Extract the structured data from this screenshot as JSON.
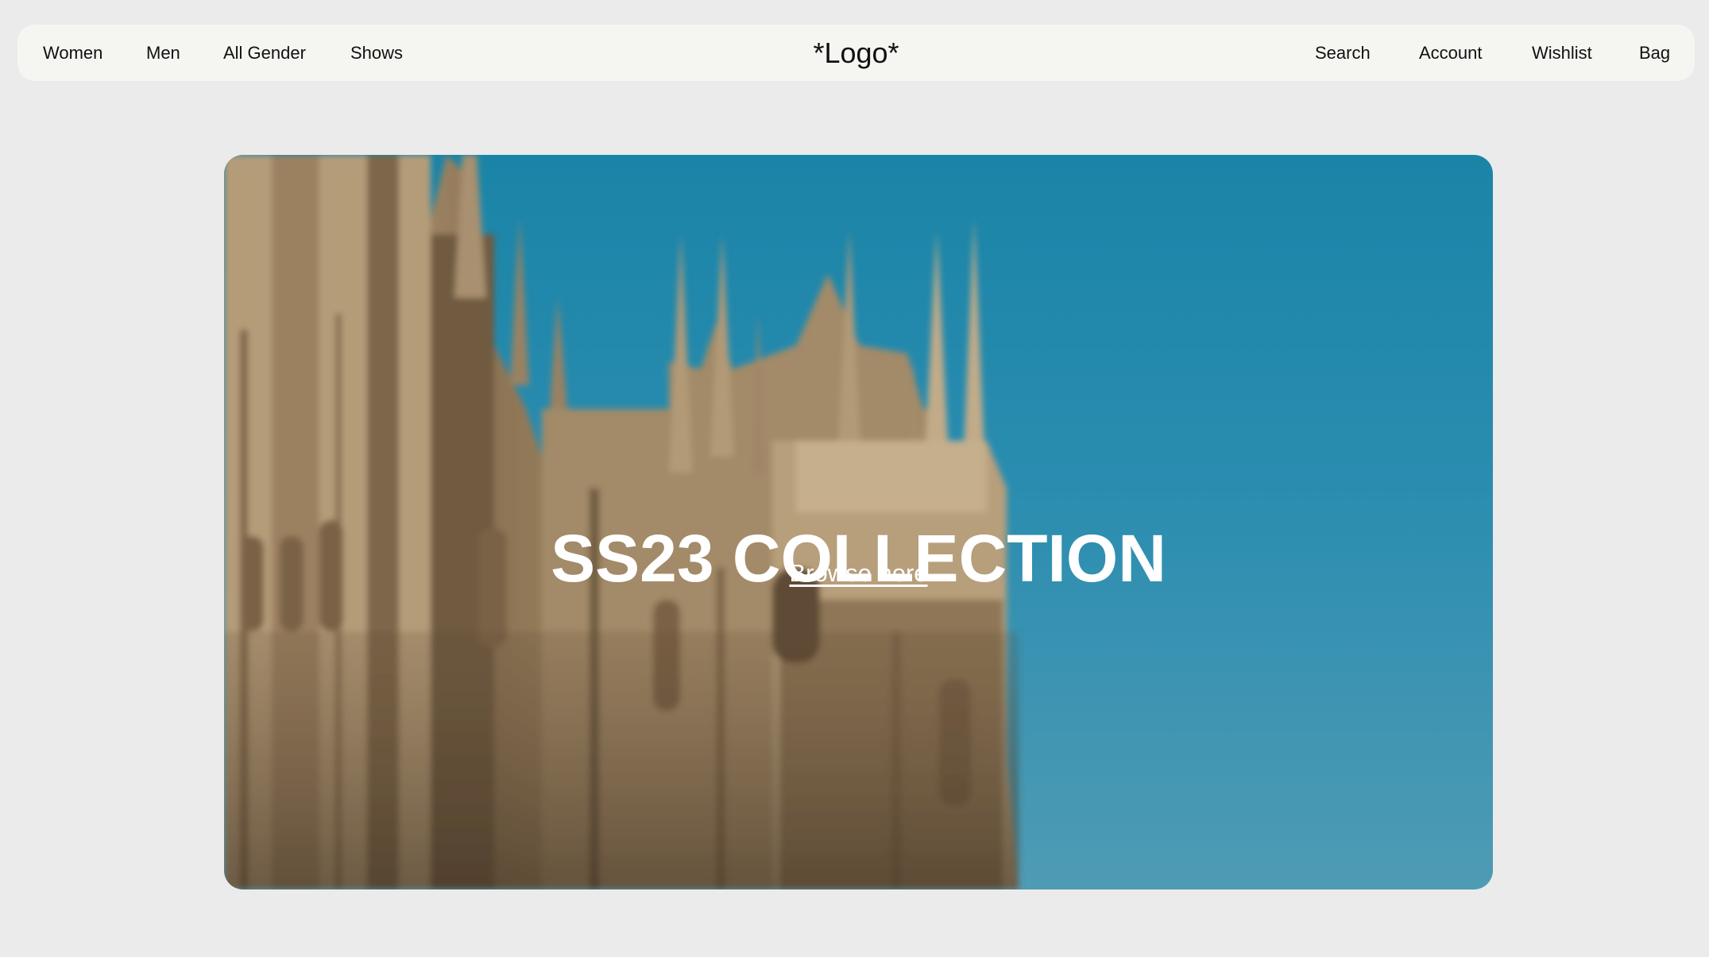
{
  "nav": {
    "left_links": [
      "Women",
      "Men",
      "All Gender",
      "Shows"
    ],
    "logo": "*Logo*",
    "right_links": [
      "Search",
      "Account",
      "Wishlist",
      "Bag"
    ]
  },
  "hero": {
    "title": "SS23 COLLECTION",
    "link_label": "Browse here",
    "image_icon": "cathedral-photo"
  },
  "colors": {
    "page_background": "#ebebeb",
    "nav_background": "#f5f6f1",
    "sky": "#1a84a7",
    "stone": "#b49d7c",
    "hero_text": "#ffffff"
  }
}
